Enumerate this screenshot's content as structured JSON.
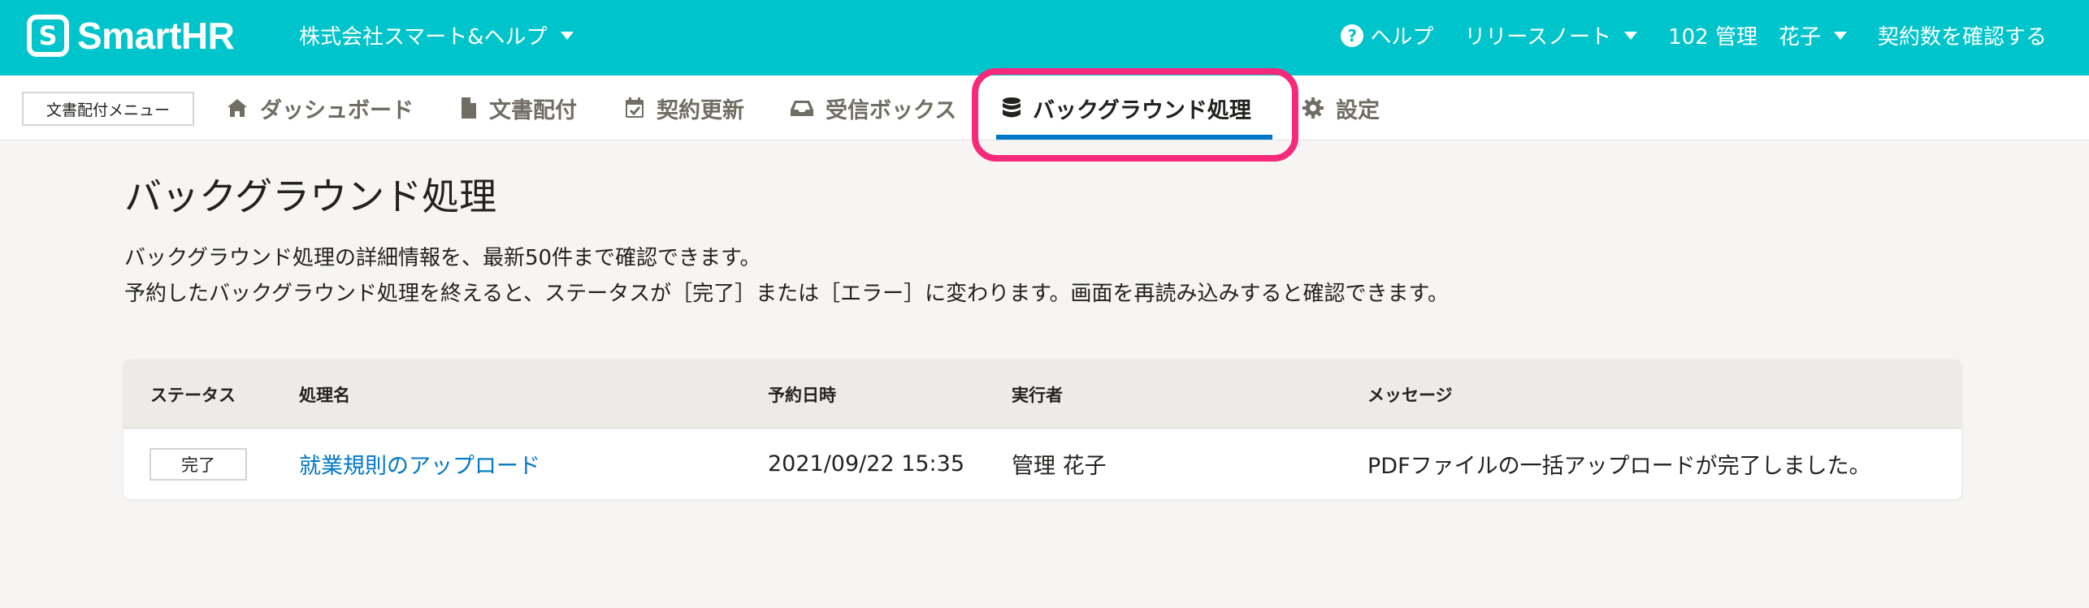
{
  "header": {
    "logo_text": "SmartHR",
    "tenant_name": "株式会社スマート&ヘルプ",
    "help_label": "ヘルプ",
    "release_notes_label": "リリースノート",
    "user_label": "102 管理　花子",
    "contract_label": "契約数を確認する",
    "background_color": "#00c4cc"
  },
  "subnav": {
    "menu_label": "文書配付メニュー",
    "tabs": [
      {
        "label": "ダッシュボード",
        "icon": "home-icon"
      },
      {
        "label": "文書配付",
        "icon": "document-icon"
      },
      {
        "label": "契約更新",
        "icon": "calendar-check-icon"
      },
      {
        "label": "受信ボックス",
        "icon": "inbox-icon"
      },
      {
        "label": "バックグラウンド処理",
        "icon": "database-icon",
        "active": true
      },
      {
        "label": "設定",
        "icon": "gear-icon"
      }
    ],
    "active_color": "#0077c7",
    "highlight_color": "#f6297a"
  },
  "main": {
    "title": "バックグラウンド処理",
    "description_line1": "バックグラウンド処理の詳細情報を、最新50件まで確認できます。",
    "description_line2": "予約したバックグラウンド処理を終えると、ステータスが［完了］または［エラー］に変わります。画面を再読み込みすると確認できます。"
  },
  "table": {
    "columns": [
      "ステータス",
      "処理名",
      "予約日時",
      "実行者",
      "メッセージ"
    ],
    "rows": [
      {
        "status": "完了",
        "name": "就業規則のアップロード",
        "scheduled_at": "2021/09/22 15:35",
        "executor": "管理 花子",
        "message": "PDFファイルの一括アップロードが完了しました。"
      }
    ]
  }
}
